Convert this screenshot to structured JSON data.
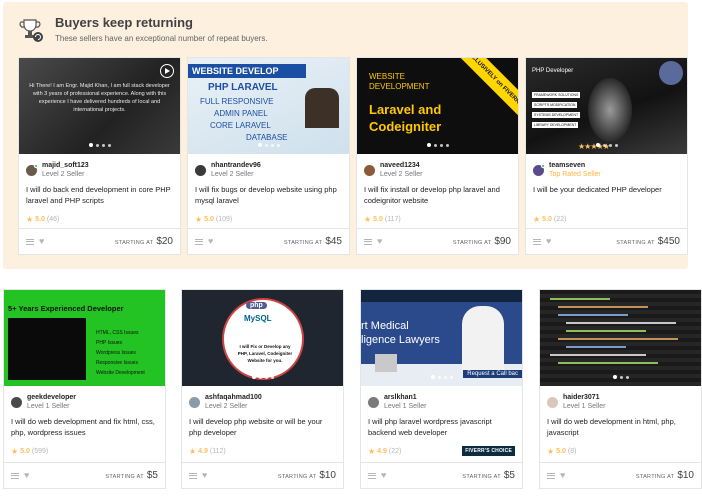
{
  "section": {
    "title": "Buyers keep returning",
    "subtitle": "These sellers have an exceptional number of repeat buyers."
  },
  "row1": [
    {
      "seller": "majid_soft123",
      "level": "Level 2 Seller",
      "title": "I will do back end development in core PHP laravel and PHP scripts",
      "score": "5.0",
      "count": "(46)",
      "starting": "STARTING AT",
      "price": "$20",
      "thumb_text": "Hi There! I am Engr. Majid Khan, I am full stack developer with 3 years of professional experience. Along with this experience I have delivered hundreds of local and international projects."
    },
    {
      "seller": "nhantrandev96",
      "level": "Level 2 Seller",
      "title": "I will fix bugs or develop website using php mysql laravel",
      "score": "5.0",
      "count": "(109)",
      "starting": "STARTING AT",
      "price": "$45",
      "thumb_lines": [
        "WEBSITE DEVELOP",
        "PHP LARAVEL",
        "FULL RESPONSIVE",
        "ADMIN PANEL",
        "CORE LARAVEL",
        "DATABASE"
      ]
    },
    {
      "seller": "naveed1234",
      "level": "Level 2 Seller",
      "title": "I will fix install or develop php laravel and codeignitor website",
      "score": "5.0",
      "count": "(117)",
      "starting": "STARTING AT",
      "price": "$90",
      "thumb_lines": [
        "WEBSITE",
        "DEVELOPMENT",
        "Laravel and",
        "Codeigniter"
      ],
      "ribbon": "EXCLUSIVELY on FIVERR"
    },
    {
      "seller": "teamseven",
      "level": "Top Rated Seller",
      "title": "I will be your dedicated PHP developer",
      "score": "5.0",
      "count": "(22)",
      "starting": "STARTING AT",
      "price": "$450",
      "thumb_lines": [
        "PHP Developer",
        "FRAMEWORK SOLUTIONS",
        "SCRIPTS MODIFICATION",
        "SYSTEMS DEVELOPMENT",
        "LIBRARY DEVELOPMENT"
      ]
    }
  ],
  "row2": [
    {
      "seller": "geekdeveloper",
      "level": "Level 1 Seller",
      "title": "I will do web development and fix html, css, php, wordpress issues",
      "score": "5.0",
      "count": "(599)",
      "starting": "STARTING AT",
      "price": "$5",
      "thumb_lines": [
        "5+ Years Experienced Developer",
        "HTML, CSS Issues",
        "PHP Issues",
        "Wordpress Issues",
        "Responsive Issues",
        "Website Development"
      ]
    },
    {
      "seller": "ashfaqahmad100",
      "level": "Level 2 Seller",
      "title": "I will develop php website or will be your php developer",
      "score": "4.9",
      "count": "(112)",
      "starting": "STARTING AT",
      "price": "$10",
      "thumb_lines": [
        "php",
        "MySQL",
        "I will Fix or Develop any",
        "PHP, Laravel, Codeigniter",
        "Website for you."
      ]
    },
    {
      "seller": "arslkhan1",
      "level": "Level 1 Seller",
      "title": "I will php laravel wordpress javascript backend web developer",
      "score": "4.9",
      "count": "(22)",
      "badge": "FIVERR'S CHOICE",
      "starting": "STARTING AT",
      "price": "$5",
      "thumb_lines": [
        "rt Medical",
        "ligence Lawyers",
        "Request a Call bac"
      ]
    },
    {
      "seller": "haider3071",
      "level": "Level 1 Seller",
      "title": "I will do web development in html, php, javascript",
      "score": "5.0",
      "count": "(8)",
      "starting": "STARTING AT",
      "price": "$10"
    }
  ],
  "colors": {
    "section_bg": "#fdf0de",
    "star": "#ffbe5b",
    "top_rated": "#ffb33e",
    "online": "#1dbf73"
  }
}
